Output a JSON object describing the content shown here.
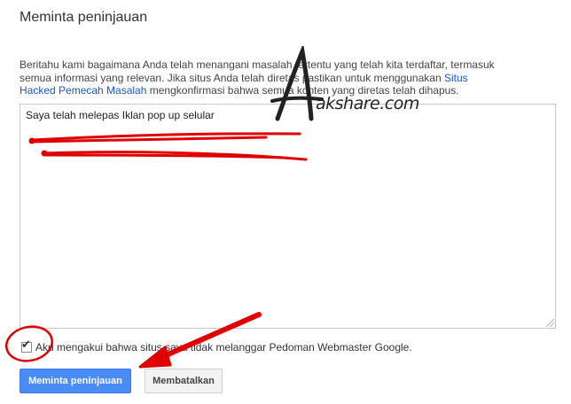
{
  "dialog": {
    "title": "Meminta peninjauan",
    "description_line1": "Beritahu kami bagaimana Anda telah menangani masalah tertentu yang telah kita terdaftar, termasuk",
    "description_line2": "semua informasi yang relevan. Jika situs Anda telah diretas pastikan untuk menggunakan ",
    "description_link_part1": "Situs",
    "description_link_part2": "Hacked Pemecah Masalah",
    "description_line3_rest": " mengkonfirmasi bahwa semua konten yang diretas telah dihapus."
  },
  "request_textarea": {
    "value": "Saya telah melepas Iklan pop up selular"
  },
  "acknowledge": {
    "label": "Aku mengakui bahwa situs saya tidak melanggar Pedoman Webmaster Google.",
    "checked": true
  },
  "buttons": {
    "submit_label": "Meminta peninjauan",
    "cancel_label": "Membatalkan"
  },
  "watermark": {
    "text": "akshare.com"
  },
  "colors": {
    "primary_button": "#4a8cf7",
    "link": "#1a57cc",
    "annotation_red": "#e00000"
  }
}
